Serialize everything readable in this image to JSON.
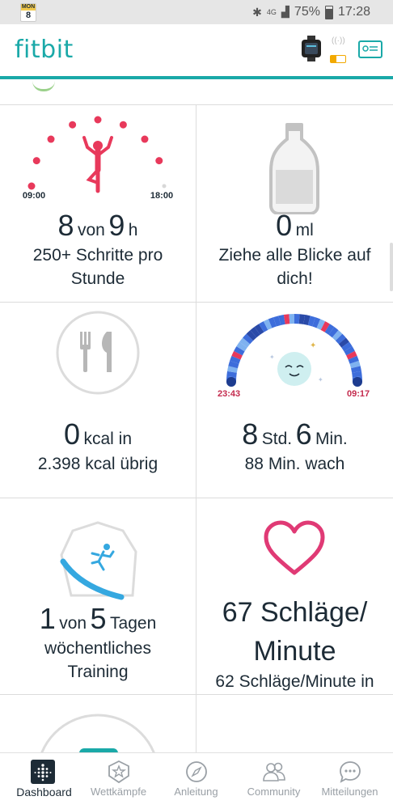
{
  "status_bar": {
    "calendar_month": "MON",
    "calendar_day": "8",
    "network": "4G",
    "battery_percent": "75%",
    "time": "17:28"
  },
  "app_bar": {
    "logo": "fitbit",
    "device_battery_level": 0.4,
    "icons": [
      "watch-icon",
      "signal-icon",
      "battery-icon",
      "profile-card-icon"
    ]
  },
  "tiles": {
    "hourly": {
      "value": "8",
      "mid": "von",
      "goal": "9",
      "unit": "h",
      "start_time": "09:00",
      "end_time": "18:00",
      "desc1": "250+ Schritte pro",
      "desc2": "Stunde"
    },
    "water": {
      "value": "0",
      "unit": "ml",
      "desc1": "Ziehe alle Blicke auf",
      "desc2": "dich!"
    },
    "food": {
      "value": "0",
      "unit": "kcal in",
      "desc": "2.398 kcal übrig"
    },
    "sleep": {
      "start": "23:43",
      "end": "09:17",
      "hours": "8",
      "hours_unit": "Std.",
      "minutes": "6",
      "minutes_unit": "Min.",
      "desc": "88 Min. wach"
    },
    "exercise": {
      "value": "1",
      "mid": "von",
      "goal": "5",
      "unit": "Tagen",
      "desc1": "wöchentliches",
      "desc2": "Training"
    },
    "heart": {
      "line1": "67 Schläge/",
      "line2": "Minute",
      "line3": "62 Schläge/Minute in"
    }
  },
  "nav": {
    "items": [
      {
        "label": "Dashboard",
        "icon": "dashboard-icon",
        "active": true
      },
      {
        "label": "Wettkämpfe",
        "icon": "star-badge-icon",
        "active": false
      },
      {
        "label": "Anleitung",
        "icon": "compass-icon",
        "active": false
      },
      {
        "label": "Community",
        "icon": "people-icon",
        "active": false
      },
      {
        "label": "Mitteilungen",
        "icon": "chat-bubble-icon",
        "active": false
      }
    ]
  },
  "colors": {
    "brand": "#1aa9a8",
    "hourly_red": "#e8395b",
    "sleep_blue": "#3d6ddb",
    "heart_pink": "#e03a75",
    "exercise_blue": "#35a8e0"
  }
}
